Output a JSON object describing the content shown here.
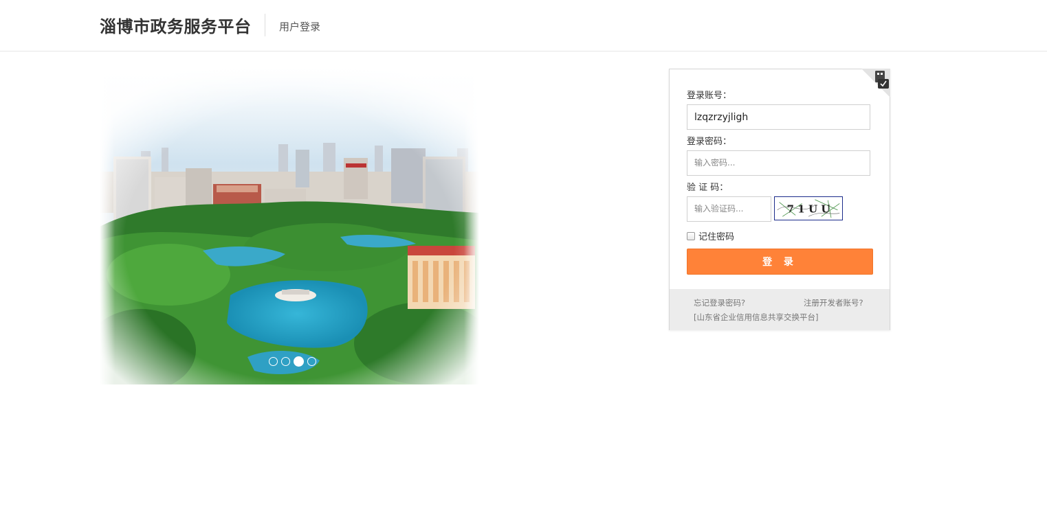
{
  "header": {
    "site_title": "淄博市政务服务平台",
    "page_subtitle": "用户登录"
  },
  "banner": {
    "slides_count": 4,
    "active_slide": 3
  },
  "login": {
    "account_label": "登录账号：",
    "account_value": "lzqzrzyjligh",
    "password_label": "登录密码：",
    "password_placeholder": "输入密码...",
    "captcha_label": "验 证 码：",
    "captcha_placeholder": "输入验证码...",
    "captcha_text": "7 1 U U",
    "remember_label": "记住密码",
    "login_button": "登 录",
    "forgot_link": "忘记登录密码?",
    "register_link": "注册开发者账号?",
    "platform_link": "[山东省企业信用信息共享交换平台]"
  },
  "colors": {
    "accent": "#ff8238",
    "captcha_border": "#1a2a8a"
  },
  "icons": {
    "corner": "usb-key-check-icon"
  }
}
